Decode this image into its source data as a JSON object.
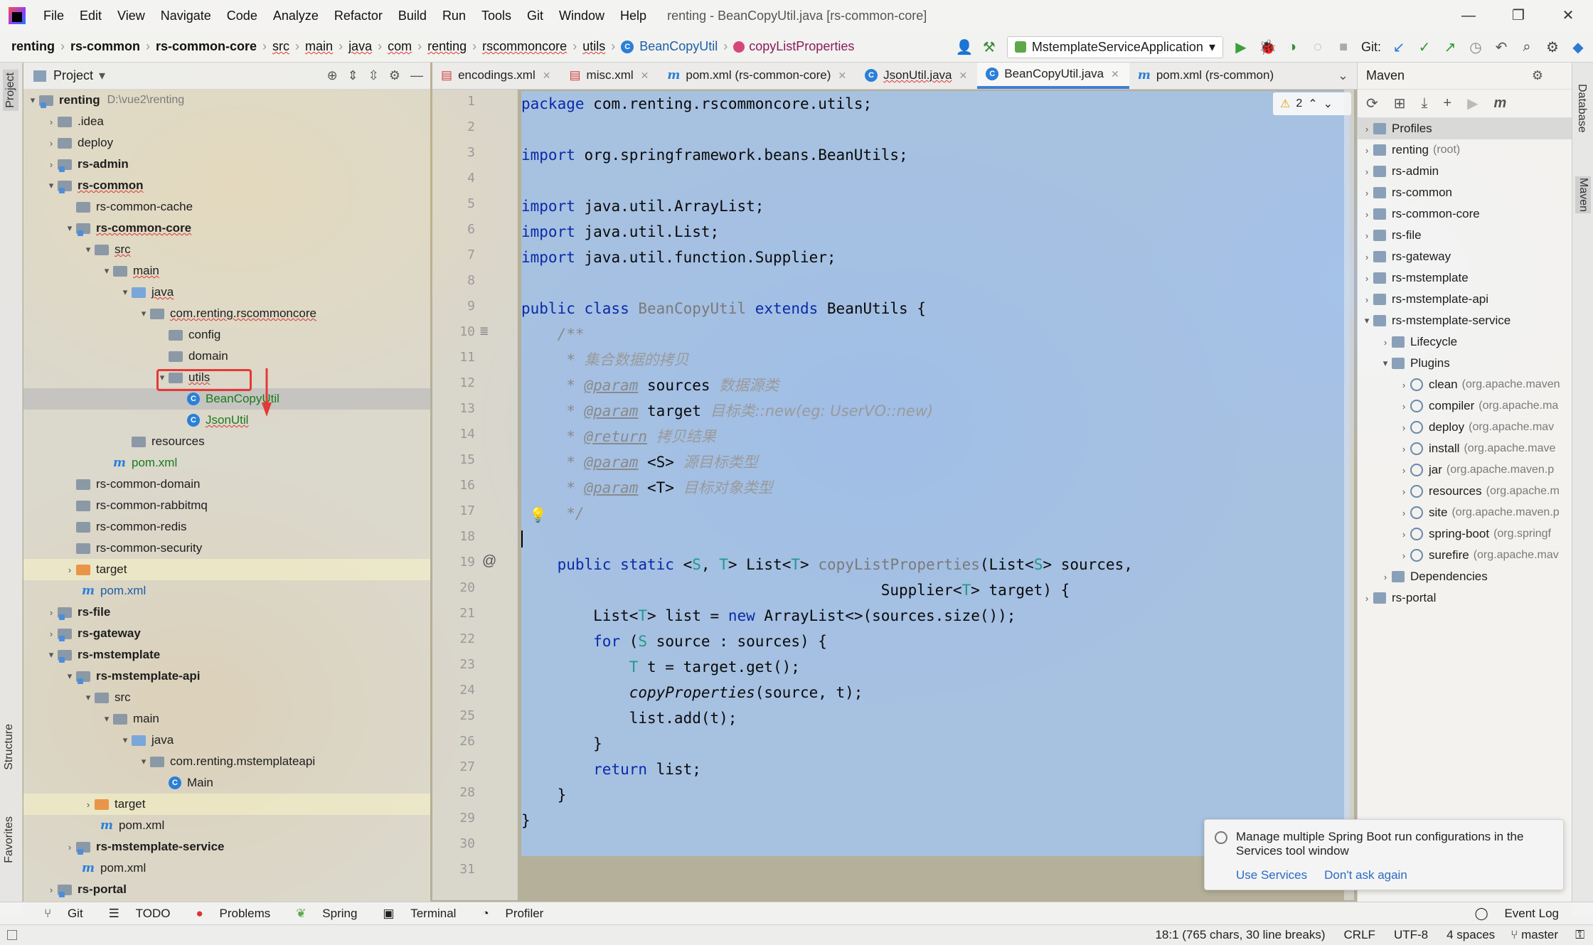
{
  "window": {
    "title": "renting - BeanCopyUtil.java [rs-common-core]"
  },
  "menu": [
    "File",
    "Edit",
    "View",
    "Navigate",
    "Code",
    "Analyze",
    "Refactor",
    "Build",
    "Run",
    "Tools",
    "Git",
    "Window",
    "Help"
  ],
  "breadcrumbs": [
    "renting",
    "rs-common",
    "rs-common-core",
    "src",
    "main",
    "java",
    "com",
    "renting",
    "rscommoncore",
    "utils",
    "BeanCopyUtil",
    "copyListProperties"
  ],
  "run_config": "MstemplateServiceApplication",
  "git_label": "Git:",
  "project_panel": {
    "title": "Project"
  },
  "tree": [
    {
      "label": "renting",
      "path": "D:\\vue2\\renting"
    },
    {
      "label": ".idea"
    },
    {
      "label": "deploy"
    },
    {
      "label": "rs-admin"
    },
    {
      "label": "rs-common"
    },
    {
      "label": "rs-common-cache"
    },
    {
      "label": "rs-common-core"
    },
    {
      "label": "src"
    },
    {
      "label": "main"
    },
    {
      "label": "java"
    },
    {
      "label": "com.renting.rscommoncore"
    },
    {
      "label": "config"
    },
    {
      "label": "domain"
    },
    {
      "label": "utils"
    },
    {
      "label": "BeanCopyUtil"
    },
    {
      "label": "JsonUtil"
    },
    {
      "label": "resources"
    },
    {
      "label": "pom.xml"
    },
    {
      "label": "rs-common-domain"
    },
    {
      "label": "rs-common-rabbitmq"
    },
    {
      "label": "rs-common-redis"
    },
    {
      "label": "rs-common-security"
    },
    {
      "label": "target"
    },
    {
      "label": "pom.xml"
    },
    {
      "label": "rs-file"
    },
    {
      "label": "rs-gateway"
    },
    {
      "label": "rs-mstemplate"
    },
    {
      "label": "rs-mstemplate-api"
    },
    {
      "label": "src"
    },
    {
      "label": "main"
    },
    {
      "label": "java"
    },
    {
      "label": "com.renting.mstemplateapi"
    },
    {
      "label": "Main"
    },
    {
      "label": "target"
    },
    {
      "label": "pom.xml"
    },
    {
      "label": "rs-mstemplate-service"
    },
    {
      "label": "pom.xml"
    },
    {
      "label": "rs-portal"
    }
  ],
  "tabs": [
    "encodings.xml",
    "misc.xml",
    "pom.xml (rs-common-core)",
    "JsonUtil.java",
    "BeanCopyUtil.java",
    "pom.xml (rs-common)"
  ],
  "warnings": "2",
  "code": {
    "l1": "com.renting.rscommoncore.utils;",
    "l3": "org.springframework.beans.BeanUtils;",
    "l5": "java.util.ArrayList;",
    "l6": "java.util.List;",
    "l7": "java.util.function.Supplier;",
    "c11": "集合数据的拷贝",
    "c12": "数据源类",
    "c13": "目标类::new(eg: UserVO::new)",
    "c14": "拷贝结果",
    "c15": "源目标类型",
    "c16": "目标对象类型"
  },
  "maven": {
    "title": "Maven",
    "items": [
      "Profiles",
      "renting",
      "(root)",
      "rs-admin",
      "rs-common",
      "rs-common-core",
      "rs-file",
      "rs-gateway",
      "rs-mstemplate",
      "rs-mstemplate-api",
      "rs-mstemplate-service",
      "Lifecycle",
      "Plugins",
      "Dependencies",
      "rs-portal"
    ],
    "plugins": [
      {
        "name": "clean",
        "detail": "(org.apache.maven"
      },
      {
        "name": "compiler",
        "detail": "(org.apache.ma"
      },
      {
        "name": "deploy",
        "detail": "(org.apache.mav"
      },
      {
        "name": "install",
        "detail": "(org.apache.mave"
      },
      {
        "name": "jar",
        "detail": "(org.apache.maven.p"
      },
      {
        "name": "resources",
        "detail": "(org.apache.m"
      },
      {
        "name": "site",
        "detail": "(org.apache.maven.p"
      },
      {
        "name": "spring-boot",
        "detail": "(org.springf"
      },
      {
        "name": "surefire",
        "detail": "(org.apache.mav"
      }
    ]
  },
  "side_labels": {
    "project": "Project",
    "structure": "Structure",
    "favorites": "Favorites",
    "database": "Database",
    "maven": "Maven"
  },
  "notification": {
    "text": "Manage multiple Spring Boot run configurations in the Services tool window",
    "link1": "Use Services",
    "link2": "Don't ask again"
  },
  "bottom_tools": [
    "Git",
    "TODO",
    "Problems",
    "Spring",
    "Terminal",
    "Profiler"
  ],
  "event_log": "Event Log",
  "status": {
    "position": "18:1 (765 chars, 30 line breaks)",
    "line_sep": "CRLF",
    "encoding": "UTF-8",
    "indent": "4 spaces",
    "branch": "master"
  },
  "colors": {
    "accent": "#3d7fd6",
    "selection": "#a3c5f0",
    "annotation_red": "#e53935"
  }
}
